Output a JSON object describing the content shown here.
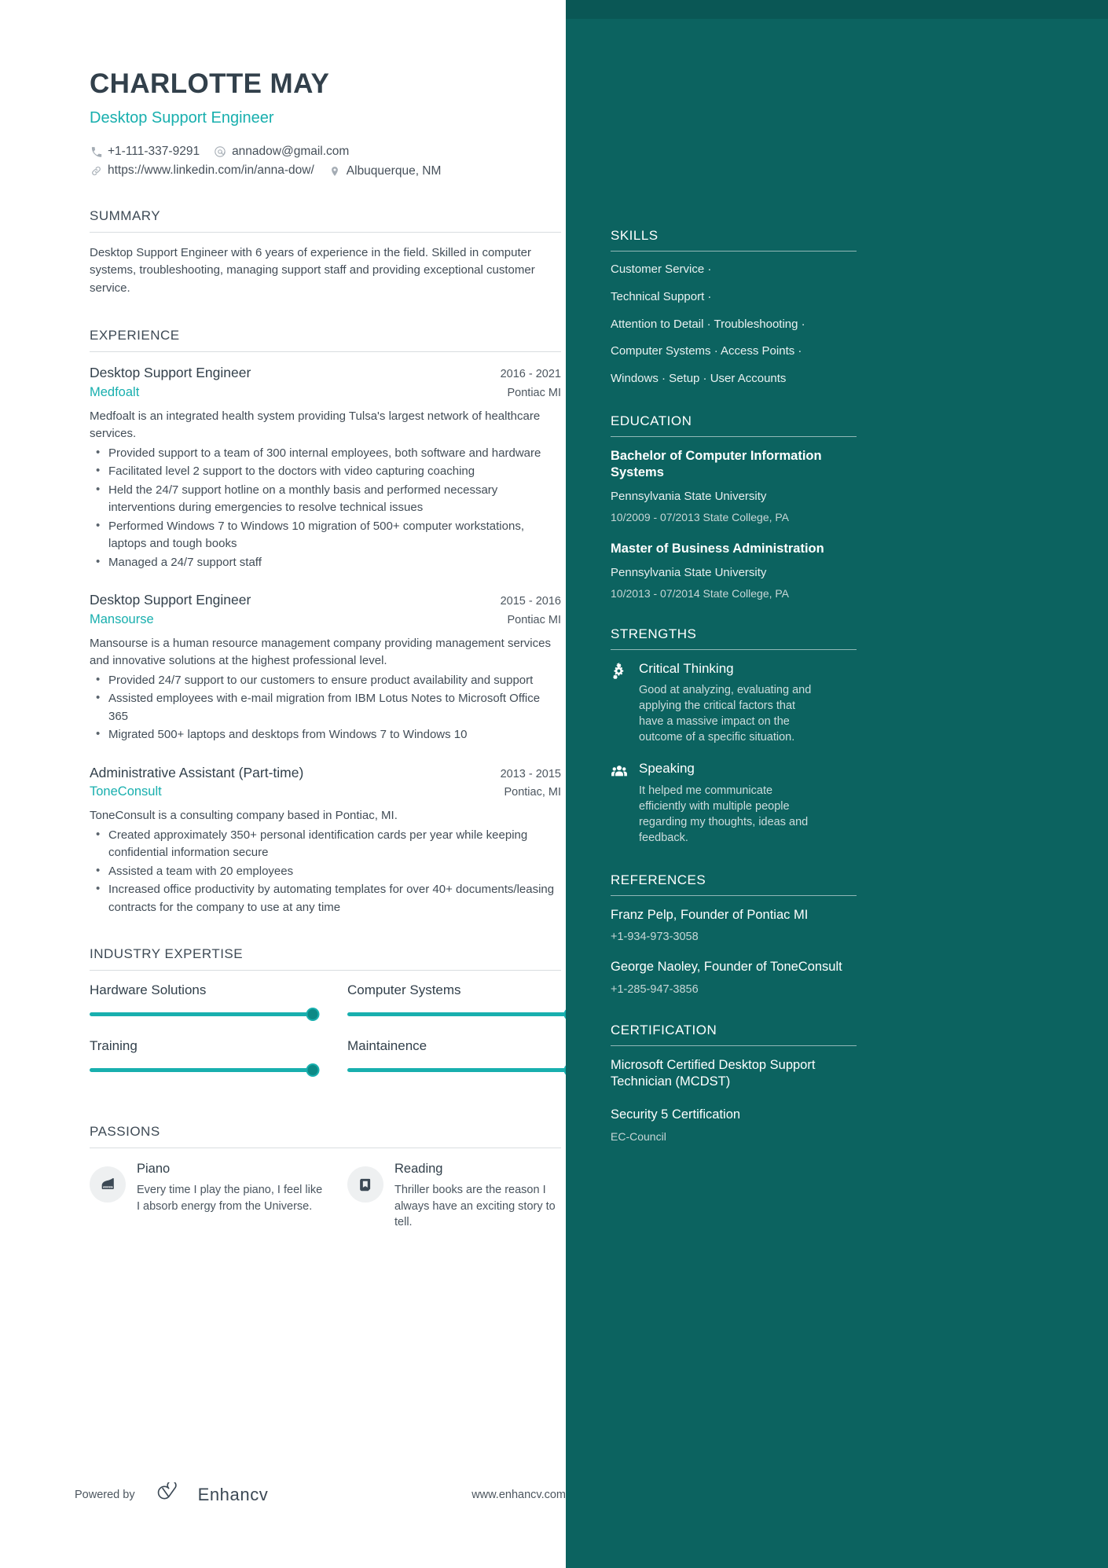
{
  "colors": {
    "sidebar_bg": "#0c6360",
    "accent": "#18afae",
    "heading": "#32404b",
    "body_text": "#424d57"
  },
  "header": {
    "name": "CHARLOTTE MAY",
    "role": "Desktop Support Engineer",
    "contacts": [
      {
        "icon": "phone-icon",
        "value": "+1-111-337-9291"
      },
      {
        "icon": "email-icon",
        "value": "annadow@gmail.com"
      },
      {
        "icon": "link-icon",
        "value": "https://www.linkedin.com/in/anna-dow/"
      },
      {
        "icon": "location-icon",
        "value": "Albuquerque, NM"
      }
    ]
  },
  "summary": {
    "title": "SUMMARY",
    "text": "Desktop Support Engineer with 6 years of experience in the field. Skilled in computer systems, troubleshooting, managing support staff and providing exceptional customer service."
  },
  "experience": {
    "title": "EXPERIENCE",
    "jobs": [
      {
        "title": "Desktop Support Engineer",
        "dates": "2016 - 2021",
        "company": "Medfoalt",
        "location": "Pontiac MI",
        "description": "Medfoalt is an integrated health system providing Tulsa's largest network of healthcare services.",
        "bullets": [
          "Provided support to a team of 300 internal employees, both software and hardware",
          "Facilitated level 2 support to the doctors with video capturing coaching",
          "Held the 24/7 support hotline on a monthly basis and performed necessary interventions during emergencies to resolve technical issues",
          "Performed Windows 7 to Windows 10 migration of 500+ computer workstations, laptops and tough books",
          "Managed a 24/7 support staff"
        ]
      },
      {
        "title": "Desktop Support Engineer",
        "dates": "2015 - 2016",
        "company": "Mansourse",
        "location": "Pontiac MI",
        "description": "Mansourse is a human resource management company providing management services and innovative solutions at the highest professional level.",
        "bullets": [
          "Provided 24/7 support to our customers to ensure product availability and support",
          "Assisted employees with e-mail migration from IBM Lotus Notes to Microsoft Office 365",
          "Migrated 500+ laptops and desktops from Windows 7 to Windows 10"
        ]
      },
      {
        "title": "Administrative Assistant (Part-time)",
        "dates": "2013 - 2015",
        "company": "ToneConsult",
        "location": "Pontiac, MI",
        "description": "ToneConsult is a consulting company based in Pontiac, MI.",
        "bullets": [
          "Created approximately 350+ personal identification cards per year while keeping confidential information secure",
          "Assisted a team with 20 employees",
          "Increased office productivity by automating templates for over 40+ documents/leasing contracts for the company to use at any time"
        ]
      }
    ]
  },
  "industry_expertise": {
    "title": "INDUSTRY EXPERTISE",
    "items": [
      {
        "label": "Hardware Solutions",
        "level": 100
      },
      {
        "label": "Computer Systems",
        "level": 100
      },
      {
        "label": "Training",
        "level": 100
      },
      {
        "label": "Maintainence",
        "level": 100
      }
    ]
  },
  "passions": {
    "title": "PASSIONS",
    "items": [
      {
        "icon": "piano-icon",
        "title": "Piano",
        "text": "Every time I play the piano, I feel like I absorb energy from the Universe."
      },
      {
        "icon": "book-icon",
        "title": "Reading",
        "text": "Thriller books are the reason I always have an exciting story to tell."
      }
    ]
  },
  "footer": {
    "powered_by": "Powered by",
    "brand": "Enhancv",
    "site": "www.enhancv.com"
  },
  "sidebar": {
    "skills": {
      "title": "SKILLS",
      "lines": [
        "Customer Service ·",
        "Technical Support ·",
        "Attention to Detail · Troubleshooting ·",
        "Computer Systems · Access Points ·",
        "Windows · Setup · User Accounts"
      ]
    },
    "education": {
      "title": "EDUCATION",
      "items": [
        {
          "degree": "Bachelor of Computer Information Systems",
          "school": "Pennsylvania State University",
          "meta": "10/2009 - 07/2013  State College, PA"
        },
        {
          "degree": "Master of Business Administration",
          "school": "Pennsylvania State University",
          "meta": "10/2013 - 07/2014  State College, PA"
        }
      ]
    },
    "strengths": {
      "title": "STRENGTHS",
      "items": [
        {
          "icon": "gears-icon",
          "title": "Critical Thinking",
          "text": "Good at analyzing, evaluating and applying the critical factors that have a massive impact on the outcome of a specific situation."
        },
        {
          "icon": "people-icon",
          "title": "Speaking",
          "text": "It helped me communicate efficiently with multiple people regarding my thoughts, ideas and feedback."
        }
      ]
    },
    "references": {
      "title": "REFERENCES",
      "items": [
        {
          "name": "Franz Pelp, Founder of Pontiac MI",
          "phone": "+1-934-973-3058"
        },
        {
          "name": "George Naoley, Founder of ToneConsult",
          "phone": "+1-285-947-3856"
        }
      ]
    },
    "certification": {
      "title": "CERTIFICATION",
      "items": [
        {
          "name": "Microsoft Certified Desktop Support Technician (MCDST)",
          "issuer": ""
        },
        {
          "name": "Security 5 Certification",
          "issuer": "EC-Council"
        }
      ]
    }
  }
}
